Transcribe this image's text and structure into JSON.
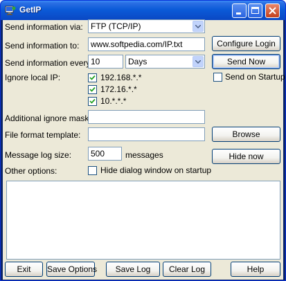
{
  "window": {
    "title": "GetIP"
  },
  "labels": {
    "send_via": "Send information via:",
    "send_to": "Send information to:",
    "send_every": "Send information every:",
    "ignore_local": "Ignore local IP:",
    "additional_masks": "Additional ignore masks:",
    "file_format": "File format template:",
    "log_size": "Message log size:",
    "messages_unit": "messages",
    "other_options": "Other options:"
  },
  "fields": {
    "send_via_value": "FTP (TCP/IP)",
    "send_to_value": "www.softpedia.com/IP.txt",
    "interval_value": "10",
    "interval_unit": "Days",
    "additional_masks_value": "",
    "file_format_value": "",
    "log_size_value": "500"
  },
  "ignore_ips": [
    {
      "label": "192.168.*.*",
      "checked": true
    },
    {
      "label": "172.16.*.*",
      "checked": true
    },
    {
      "label": "10.*.*.*",
      "checked": true
    }
  ],
  "options": {
    "send_on_startup": {
      "label": "Send on Startup",
      "checked": false
    },
    "hide_on_startup": {
      "label": "Hide dialog window on startup",
      "checked": false
    }
  },
  "side_buttons": {
    "configure_login": "Configure Login",
    "send_now": "Send Now",
    "browse": "Browse",
    "hide_now": "Hide now"
  },
  "bottom_buttons": {
    "exit": "Exit",
    "save_options": "Save Options",
    "save_log": "Save Log",
    "clear_log": "Clear Log",
    "help": "Help"
  },
  "icons": {
    "app": "getip-app-icon",
    "minimize": "minimize-icon",
    "maximize": "maximize-icon",
    "close": "close-icon",
    "dropdown": "chevron-down-icon",
    "check": "check-icon"
  },
  "colors": {
    "titlebar": "#0b5bd8",
    "client_bg": "#ece9d8",
    "close_button": "#c5401c",
    "field_border": "#7f9db9"
  }
}
